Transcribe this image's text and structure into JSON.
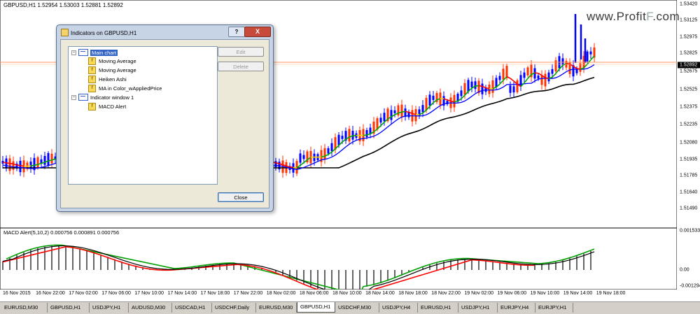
{
  "chart": {
    "title": "GBPUSD,H1  1.52954 1.53003 1.52881 1.52892",
    "watermark_main": "www.Profit",
    "watermark_f": "F",
    "watermark_end": ".com",
    "current_price": "1.52892",
    "price_labels": [
      "1.53420",
      "1.53125",
      "1.52975",
      "1.52825",
      "1.52675",
      "1.52525",
      "1.52375",
      "1.52235",
      "1.52080",
      "1.51935",
      "1.51785",
      "1.51640",
      "1.51490"
    ],
    "macd_title": "MACD Alert(5,10,2) 0.000756 0.000891 0.000756",
    "macd_labels": [
      "0.001533",
      "0.00",
      "-0.001294"
    ],
    "time_labels": [
      "16 Nov 2015",
      "16 Nov 22:00",
      "17 Nov 02:00",
      "17 Nov 06:00",
      "17 Nov 10:00",
      "17 Nov 14:00",
      "17 Nov 18:00",
      "17 Nov 22:00",
      "18 Nov 02:00",
      "18 Nov 06:00",
      "18 Nov 10:00",
      "18 Nov 14:00",
      "18 Nov 18:00",
      "18 Nov 22:00",
      "19 Nov 02:00",
      "19 Nov 06:00",
      "19 Nov 10:00",
      "19 Nov 14:00",
      "19 Nov 18:00"
    ],
    "colors": {
      "ma_fast": "#0000ff",
      "ma_slow": "#000000",
      "bull": "#0000ff",
      "bear": "#ff3300",
      "ma_color_up": "#00aa00",
      "ma_color_mid": "#ffcc00",
      "ma_color_down": "#ff0000",
      "price_line": "#ff9966"
    }
  },
  "tabs": [
    {
      "label": "EURUSD,M30",
      "active": false
    },
    {
      "label": "GBPUSD,H1",
      "active": false
    },
    {
      "label": "USDJPY,H1",
      "active": false
    },
    {
      "label": "AUDUSD,M30",
      "active": false
    },
    {
      "label": "USDCAD,H1",
      "active": false
    },
    {
      "label": "USDCHF,Daily",
      "active": false
    },
    {
      "label": "EURUSD,M30",
      "active": false
    },
    {
      "label": "GBPUSD,H1",
      "active": true
    },
    {
      "label": "USDCHF,M30",
      "active": false
    },
    {
      "label": "USDJPY,H4",
      "active": false
    },
    {
      "label": "EURUSD,H1",
      "active": false
    },
    {
      "label": "USDJPY,H1",
      "active": false
    },
    {
      "label": "EURJPY,H4",
      "active": false
    },
    {
      "label": "EURJPY,H1",
      "active": false
    }
  ],
  "dialog": {
    "title": "Indicators on GBPUSD,H1",
    "help_label": "?",
    "close_x": "X",
    "tree": {
      "main_chart": "Main chart",
      "main_items": [
        "Moving Average",
        "Moving Average",
        "Heiken Ashi",
        "MA in Color_wAppliedPrice"
      ],
      "window1": "Indicator window 1",
      "window1_items": [
        "MACD Alert"
      ]
    },
    "edit_label": "Edit",
    "delete_label": "Delete",
    "close_label": "Close"
  },
  "icons": {
    "expand": "minus-box-icon",
    "window": "window-icon",
    "indicator": "indicator-icon"
  }
}
